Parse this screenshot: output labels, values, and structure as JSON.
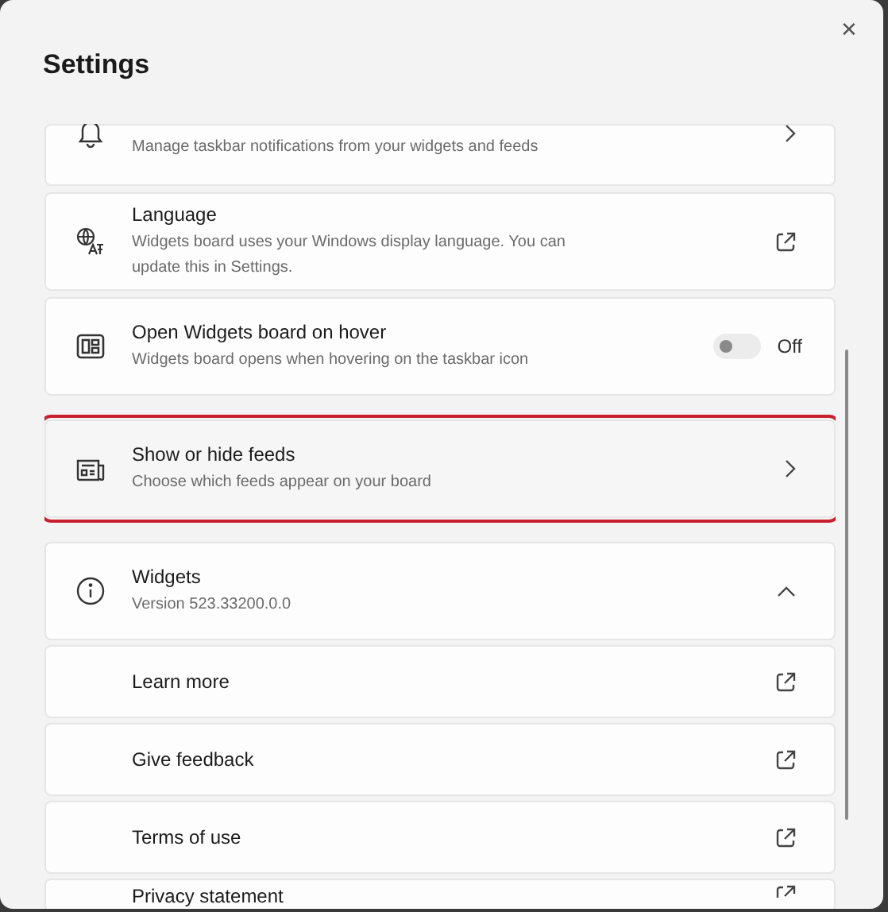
{
  "window": {
    "title": "Settings",
    "close": "✕"
  },
  "rows": [
    {
      "kind": "chevron",
      "title": "",
      "description": "Manage taskbar notifications from your widgets and feeds",
      "highlighted": false
    },
    {
      "kind": "external",
      "title": "Language",
      "description": "Widgets board uses your Windows display language. You can update this in Settings.",
      "highlighted": false
    },
    {
      "kind": "toggle",
      "title": "Open Widgets board on hover",
      "description": "Widgets board opens when hovering on the taskbar icon",
      "on": false,
      "state_label": "Off",
      "highlighted": false
    },
    {
      "kind": "chevron",
      "title": "Show or hide feeds",
      "description": "Choose which feeds appear on your board",
      "highlighted": true
    },
    {
      "kind": "expander",
      "title": "Widgets",
      "description": "Version 523.33200.0.0",
      "expanded": true,
      "highlighted": false,
      "children": [
        {
          "kind": "external",
          "title": "Learn more"
        },
        {
          "kind": "external",
          "title": "Give feedback"
        },
        {
          "kind": "external",
          "title": "Terms of use"
        },
        {
          "kind": "external",
          "title": "Privacy statement"
        }
      ]
    }
  ]
}
